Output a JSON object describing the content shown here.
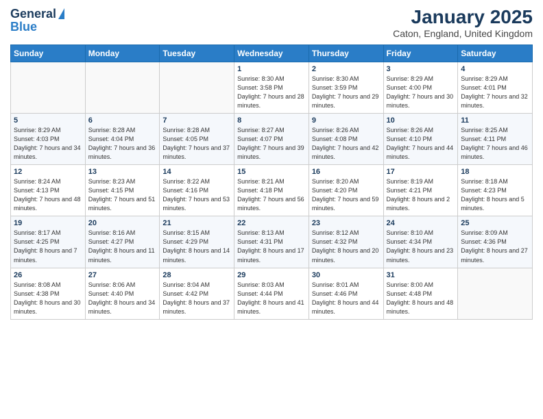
{
  "logo": {
    "line1": "General",
    "line2": "Blue"
  },
  "title": "January 2025",
  "subtitle": "Caton, England, United Kingdom",
  "days_of_week": [
    "Sunday",
    "Monday",
    "Tuesday",
    "Wednesday",
    "Thursday",
    "Friday",
    "Saturday"
  ],
  "weeks": [
    [
      {
        "day": "",
        "sunrise": "",
        "sunset": "",
        "daylight": ""
      },
      {
        "day": "",
        "sunrise": "",
        "sunset": "",
        "daylight": ""
      },
      {
        "day": "",
        "sunrise": "",
        "sunset": "",
        "daylight": ""
      },
      {
        "day": "1",
        "sunrise": "Sunrise: 8:30 AM",
        "sunset": "Sunset: 3:58 PM",
        "daylight": "Daylight: 7 hours and 28 minutes."
      },
      {
        "day": "2",
        "sunrise": "Sunrise: 8:30 AM",
        "sunset": "Sunset: 3:59 PM",
        "daylight": "Daylight: 7 hours and 29 minutes."
      },
      {
        "day": "3",
        "sunrise": "Sunrise: 8:29 AM",
        "sunset": "Sunset: 4:00 PM",
        "daylight": "Daylight: 7 hours and 30 minutes."
      },
      {
        "day": "4",
        "sunrise": "Sunrise: 8:29 AM",
        "sunset": "Sunset: 4:01 PM",
        "daylight": "Daylight: 7 hours and 32 minutes."
      }
    ],
    [
      {
        "day": "5",
        "sunrise": "Sunrise: 8:29 AM",
        "sunset": "Sunset: 4:03 PM",
        "daylight": "Daylight: 7 hours and 34 minutes."
      },
      {
        "day": "6",
        "sunrise": "Sunrise: 8:28 AM",
        "sunset": "Sunset: 4:04 PM",
        "daylight": "Daylight: 7 hours and 36 minutes."
      },
      {
        "day": "7",
        "sunrise": "Sunrise: 8:28 AM",
        "sunset": "Sunset: 4:05 PM",
        "daylight": "Daylight: 7 hours and 37 minutes."
      },
      {
        "day": "8",
        "sunrise": "Sunrise: 8:27 AM",
        "sunset": "Sunset: 4:07 PM",
        "daylight": "Daylight: 7 hours and 39 minutes."
      },
      {
        "day": "9",
        "sunrise": "Sunrise: 8:26 AM",
        "sunset": "Sunset: 4:08 PM",
        "daylight": "Daylight: 7 hours and 42 minutes."
      },
      {
        "day": "10",
        "sunrise": "Sunrise: 8:26 AM",
        "sunset": "Sunset: 4:10 PM",
        "daylight": "Daylight: 7 hours and 44 minutes."
      },
      {
        "day": "11",
        "sunrise": "Sunrise: 8:25 AM",
        "sunset": "Sunset: 4:11 PM",
        "daylight": "Daylight: 7 hours and 46 minutes."
      }
    ],
    [
      {
        "day": "12",
        "sunrise": "Sunrise: 8:24 AM",
        "sunset": "Sunset: 4:13 PM",
        "daylight": "Daylight: 7 hours and 48 minutes."
      },
      {
        "day": "13",
        "sunrise": "Sunrise: 8:23 AM",
        "sunset": "Sunset: 4:15 PM",
        "daylight": "Daylight: 7 hours and 51 minutes."
      },
      {
        "day": "14",
        "sunrise": "Sunrise: 8:22 AM",
        "sunset": "Sunset: 4:16 PM",
        "daylight": "Daylight: 7 hours and 53 minutes."
      },
      {
        "day": "15",
        "sunrise": "Sunrise: 8:21 AM",
        "sunset": "Sunset: 4:18 PM",
        "daylight": "Daylight: 7 hours and 56 minutes."
      },
      {
        "day": "16",
        "sunrise": "Sunrise: 8:20 AM",
        "sunset": "Sunset: 4:20 PM",
        "daylight": "Daylight: 7 hours and 59 minutes."
      },
      {
        "day": "17",
        "sunrise": "Sunrise: 8:19 AM",
        "sunset": "Sunset: 4:21 PM",
        "daylight": "Daylight: 8 hours and 2 minutes."
      },
      {
        "day": "18",
        "sunrise": "Sunrise: 8:18 AM",
        "sunset": "Sunset: 4:23 PM",
        "daylight": "Daylight: 8 hours and 5 minutes."
      }
    ],
    [
      {
        "day": "19",
        "sunrise": "Sunrise: 8:17 AM",
        "sunset": "Sunset: 4:25 PM",
        "daylight": "Daylight: 8 hours and 7 minutes."
      },
      {
        "day": "20",
        "sunrise": "Sunrise: 8:16 AM",
        "sunset": "Sunset: 4:27 PM",
        "daylight": "Daylight: 8 hours and 11 minutes."
      },
      {
        "day": "21",
        "sunrise": "Sunrise: 8:15 AM",
        "sunset": "Sunset: 4:29 PM",
        "daylight": "Daylight: 8 hours and 14 minutes."
      },
      {
        "day": "22",
        "sunrise": "Sunrise: 8:13 AM",
        "sunset": "Sunset: 4:31 PM",
        "daylight": "Daylight: 8 hours and 17 minutes."
      },
      {
        "day": "23",
        "sunrise": "Sunrise: 8:12 AM",
        "sunset": "Sunset: 4:32 PM",
        "daylight": "Daylight: 8 hours and 20 minutes."
      },
      {
        "day": "24",
        "sunrise": "Sunrise: 8:10 AM",
        "sunset": "Sunset: 4:34 PM",
        "daylight": "Daylight: 8 hours and 23 minutes."
      },
      {
        "day": "25",
        "sunrise": "Sunrise: 8:09 AM",
        "sunset": "Sunset: 4:36 PM",
        "daylight": "Daylight: 8 hours and 27 minutes."
      }
    ],
    [
      {
        "day": "26",
        "sunrise": "Sunrise: 8:08 AM",
        "sunset": "Sunset: 4:38 PM",
        "daylight": "Daylight: 8 hours and 30 minutes."
      },
      {
        "day": "27",
        "sunrise": "Sunrise: 8:06 AM",
        "sunset": "Sunset: 4:40 PM",
        "daylight": "Daylight: 8 hours and 34 minutes."
      },
      {
        "day": "28",
        "sunrise": "Sunrise: 8:04 AM",
        "sunset": "Sunset: 4:42 PM",
        "daylight": "Daylight: 8 hours and 37 minutes."
      },
      {
        "day": "29",
        "sunrise": "Sunrise: 8:03 AM",
        "sunset": "Sunset: 4:44 PM",
        "daylight": "Daylight: 8 hours and 41 minutes."
      },
      {
        "day": "30",
        "sunrise": "Sunrise: 8:01 AM",
        "sunset": "Sunset: 4:46 PM",
        "daylight": "Daylight: 8 hours and 44 minutes."
      },
      {
        "day": "31",
        "sunrise": "Sunrise: 8:00 AM",
        "sunset": "Sunset: 4:48 PM",
        "daylight": "Daylight: 8 hours and 48 minutes."
      },
      {
        "day": "",
        "sunrise": "",
        "sunset": "",
        "daylight": ""
      }
    ]
  ]
}
